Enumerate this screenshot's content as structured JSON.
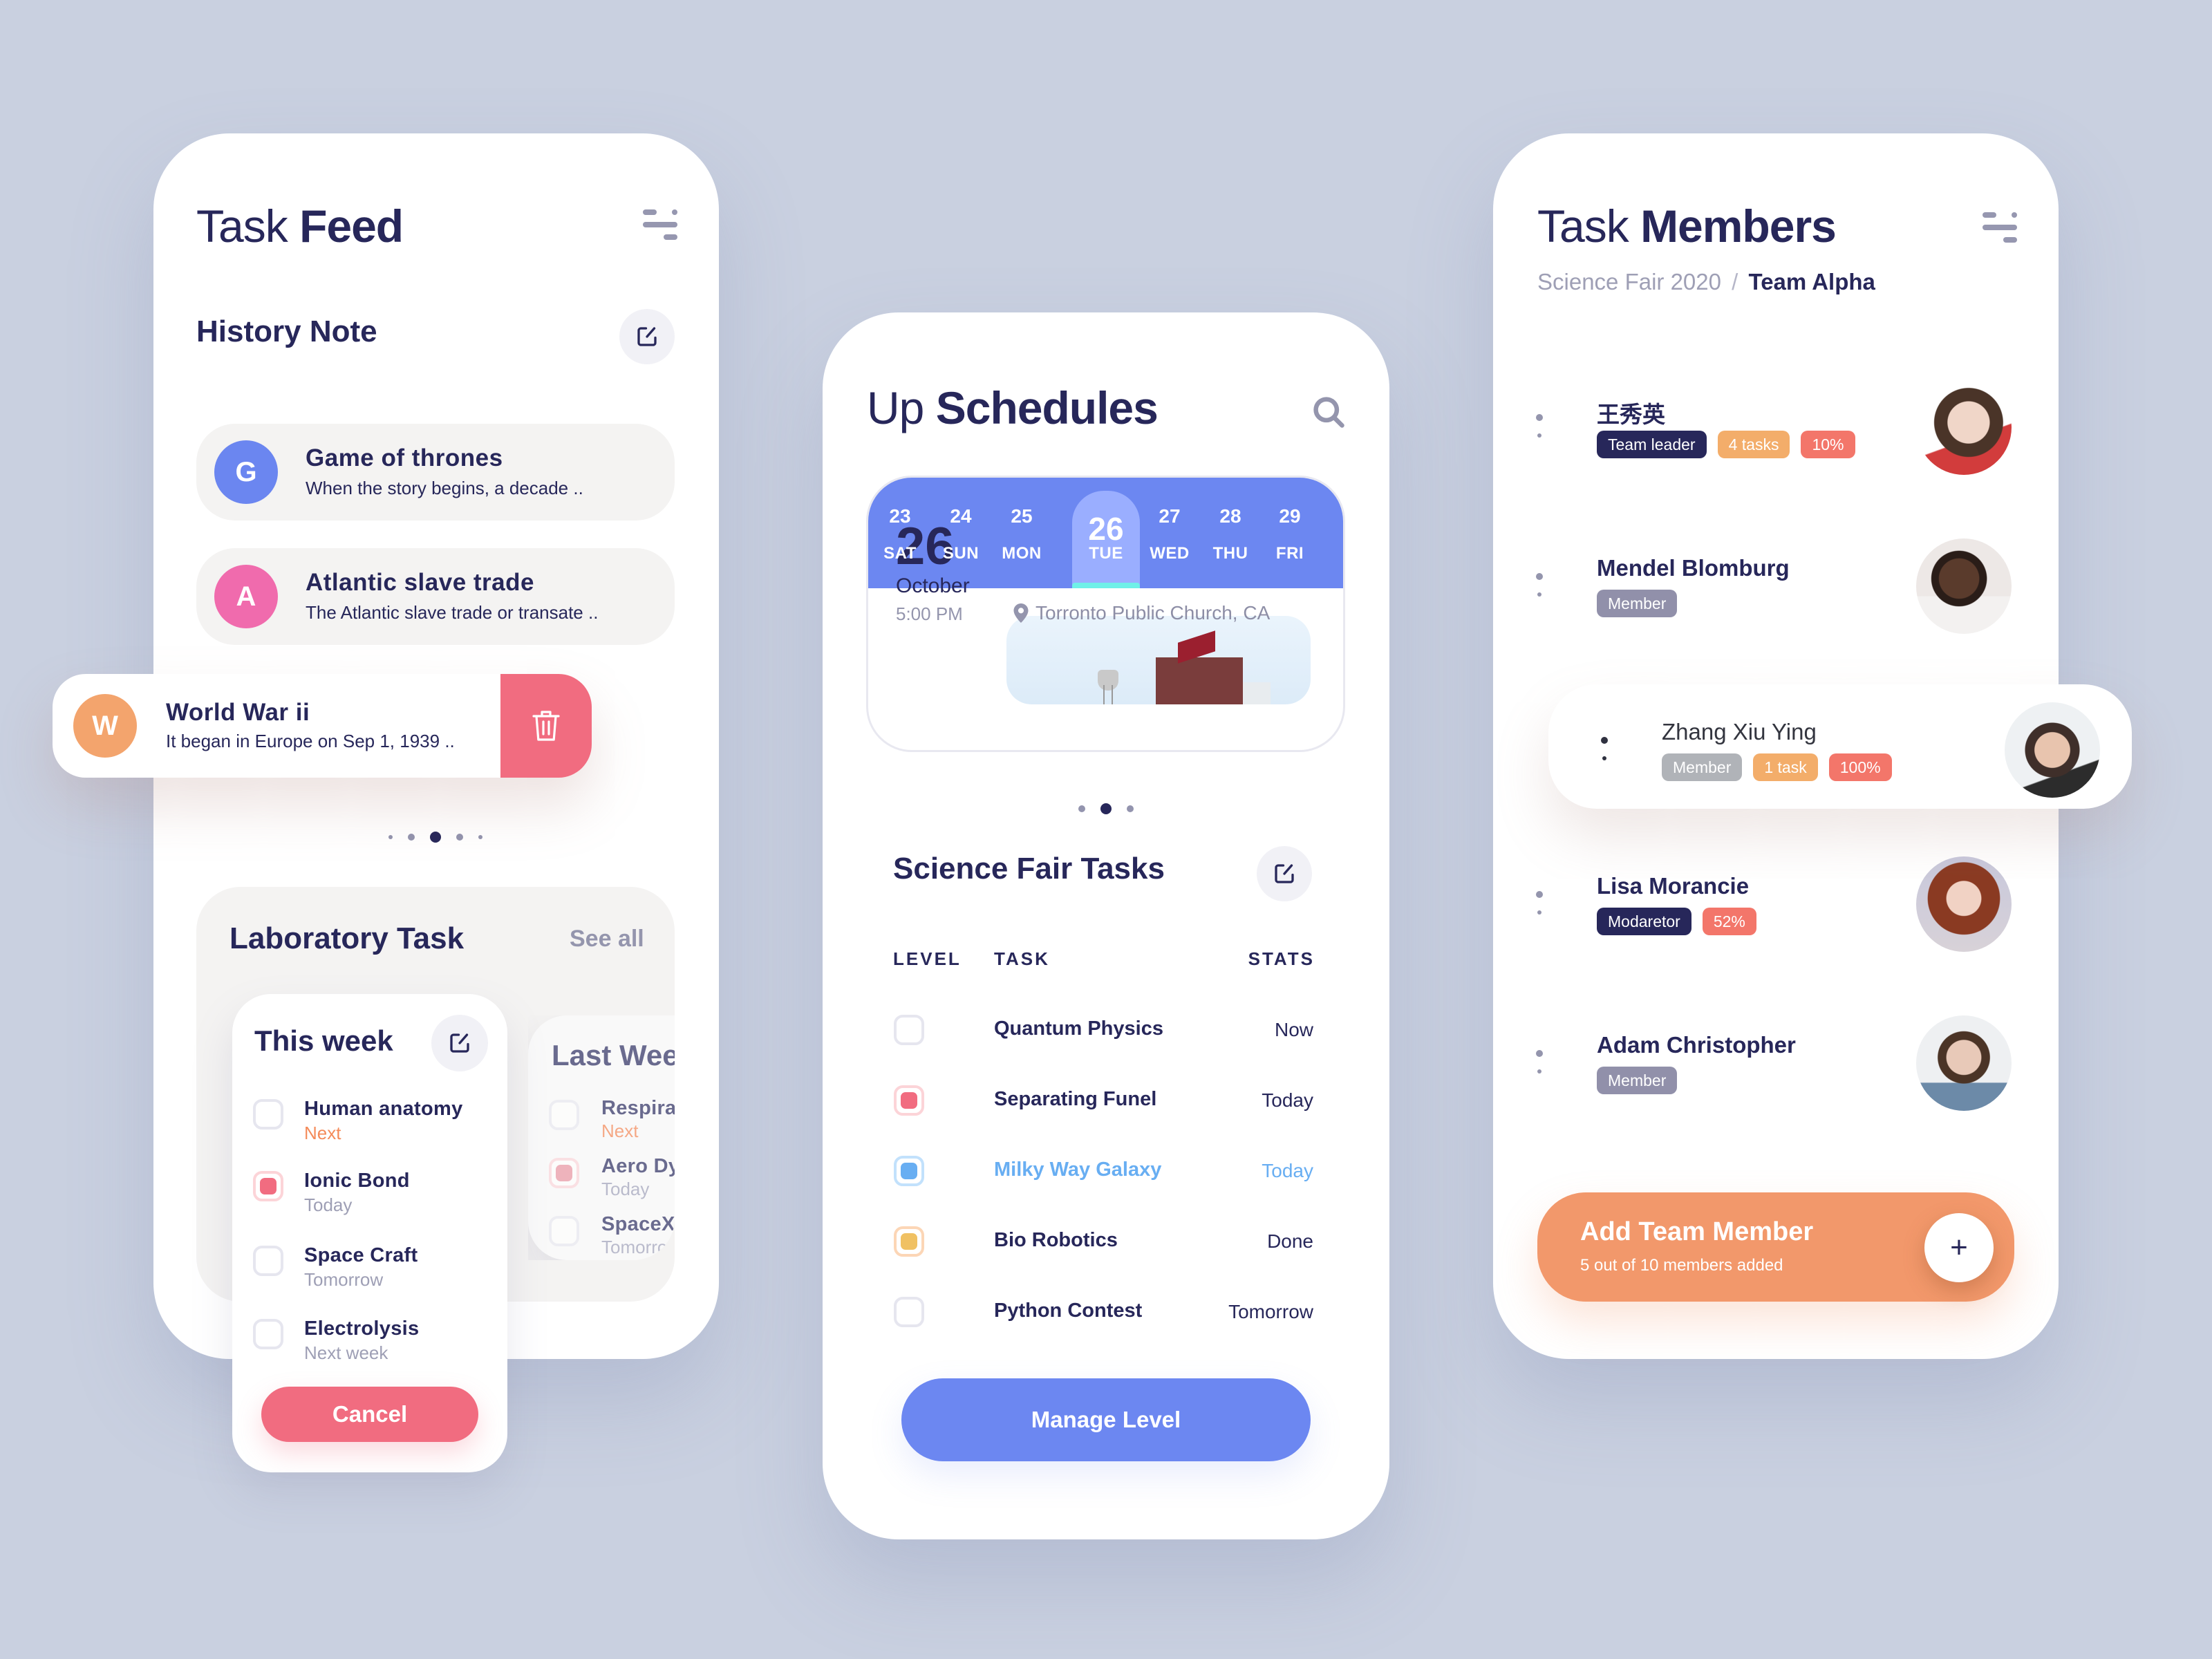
{
  "task_feed": {
    "title_light": "Task",
    "title_bold": "Feed",
    "filter_icon": "filter-icon",
    "history_title": "History Note",
    "notes": [
      {
        "letter": "G",
        "title": "Game of thrones",
        "subtitle": "When the story begins, a decade ..",
        "color": "#6b86f0"
      },
      {
        "letter": "A",
        "title": "Atlantic slave trade",
        "subtitle": "The Atlantic slave trade or transate ..",
        "color": "#f06bad"
      }
    ],
    "swiped_note": {
      "letter": "W",
      "title": "World War ii",
      "subtitle": "It began in Europe on Sep 1, 1939 ..",
      "color": "#f3a46d",
      "action": "trash-icon"
    },
    "pager": {
      "count": 5,
      "active": 2
    },
    "lab": {
      "title": "Laboratory Task",
      "see_all": "See all",
      "this_week": {
        "title": "This week",
        "tasks": [
          {
            "name": "Human anatomy",
            "when": "Next",
            "checked": false,
            "when_color": "#f48b5a"
          },
          {
            "name": "Ionic Bond",
            "when": "Today",
            "checked": true,
            "when_color": "#9e9fb5"
          },
          {
            "name": "Space Craft",
            "when": "Tomorrow",
            "checked": false,
            "when_color": "#9e9fb5"
          },
          {
            "name": "Electrolysis",
            "when": "Next week",
            "checked": false,
            "when_color": "#9e9fb5"
          }
        ],
        "cancel": "Cancel"
      },
      "last_week": {
        "title": "Last Wee",
        "tasks": [
          {
            "name": "Respirat",
            "when": "Next",
            "checked": false,
            "when_color": "#f6a07a"
          },
          {
            "name": "Aero Dy",
            "when": "Today",
            "checked": true,
            "when_color": "#b4b5c8"
          },
          {
            "name": "SpaceX",
            "when": "Tomorro",
            "checked": false,
            "when_color": "#b4b5c8"
          }
        ]
      }
    }
  },
  "schedules": {
    "title_light": "Up",
    "title_bold": "Schedules",
    "search_icon": "search-icon",
    "days": [
      {
        "num": "23",
        "name": "SAT"
      },
      {
        "num": "24",
        "name": "SUN"
      },
      {
        "num": "25",
        "name": "MON"
      },
      {
        "num": "26",
        "name": "TUE",
        "selected": true
      },
      {
        "num": "27",
        "name": "WED"
      },
      {
        "num": "28",
        "name": "THU"
      },
      {
        "num": "29",
        "name": "FRI"
      }
    ],
    "event": {
      "day": "26",
      "month": "October",
      "time": "5:00 PM",
      "location": "Torronto Public Church, CA"
    },
    "pager": {
      "count": 3,
      "active": 1
    },
    "tasks_title": "Science Fair Tasks",
    "columns": {
      "level": "LEVEL",
      "task": "TASK",
      "stats": "STATS"
    },
    "rows": [
      {
        "task": "Quantum Physics",
        "stat": "Now",
        "level_color": null,
        "text_color": "#27275a"
      },
      {
        "task": "Separating Funel",
        "stat": "Today",
        "level_color": "#f16c80",
        "ring": "#fcd4d8",
        "text_color": "#27275a"
      },
      {
        "task": "Milky Way Galaxy",
        "stat": "Today",
        "level_color": "#68aef2",
        "ring": "#c2e1fc",
        "text_color": "#68aef2"
      },
      {
        "task": "Bio Robotics",
        "stat": "Done",
        "level_color": "#f0c163",
        "ring": "#fcd6b6",
        "text_color": "#27275a"
      },
      {
        "task": "Python Contest",
        "stat": "Tomorrow",
        "level_color": null,
        "text_color": "#27275a"
      }
    ],
    "button": "Manage Level"
  },
  "members": {
    "title_light": "Task",
    "title_bold": "Members",
    "breadcrumb": {
      "parent": "Science Fair 2020",
      "separator": "/",
      "current": "Team Alpha"
    },
    "list": [
      {
        "name": "王秀英",
        "badges": [
          {
            "text": "Team leader",
            "color": "#27275a"
          },
          {
            "text": "4 tasks",
            "color": "#f3ad6a"
          },
          {
            "text": "10%",
            "color": "#f3766a"
          }
        ]
      },
      {
        "name": "Mendel Blomburg",
        "badges": [
          {
            "text": "Member",
            "color": "#9190aa"
          }
        ]
      },
      {
        "name": "Zhang Xiu Ying",
        "badges": [
          {
            "text": "Member",
            "color": "#b0b3b8"
          },
          {
            "text": "1 task",
            "color": "#f3ad6a"
          },
          {
            "text": "100%",
            "color": "#f3766a"
          }
        ],
        "highlighted": true
      },
      {
        "name": "Lisa Morancie",
        "badges": [
          {
            "text": "Modaretor",
            "color": "#27275a"
          },
          {
            "text": "52%",
            "color": "#f3766a"
          }
        ]
      },
      {
        "name": "Adam Christopher",
        "badges": [
          {
            "text": "Member",
            "color": "#9190aa"
          }
        ]
      }
    ],
    "add": {
      "title": "Add Team Member",
      "subtitle": "5 out of 10 members added",
      "icon": "plus-icon",
      "added": 5,
      "total": 10
    }
  },
  "colors": {
    "background": "#c9d0e0",
    "primary_text": "#27275a",
    "accent_blue": "#6c87f1",
    "accent_red": "#f16c80",
    "accent_orange": "#f2986b"
  }
}
